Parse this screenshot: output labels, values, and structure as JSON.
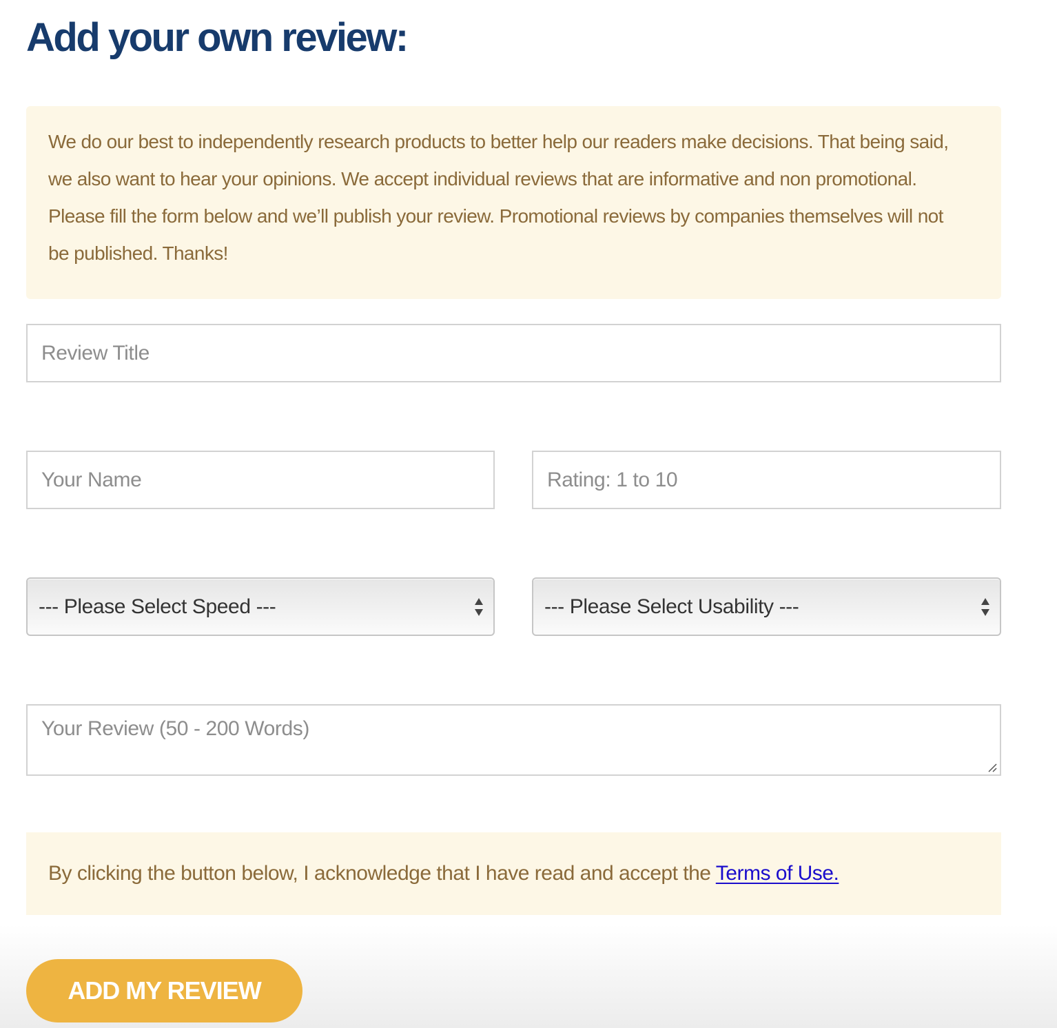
{
  "page": {
    "title": "Add your own review:"
  },
  "notice": {
    "text": "We do our best to independently research products to better help our readers make decisions. That being said, we also want to hear your opinions. We accept individual reviews that are informative and non promotional. Please fill the form below and we’ll publish your review. Promotional reviews by companies themselves will not be published. Thanks!"
  },
  "form": {
    "review_title": {
      "value": "",
      "placeholder": "Review Title"
    },
    "your_name": {
      "value": "",
      "placeholder": "Your Name"
    },
    "rating": {
      "value": "",
      "placeholder": "Rating: 1 to 10"
    },
    "speed_select": {
      "selected": "--- Please Select Speed ---"
    },
    "usability_select": {
      "selected": "--- Please Select Usability ---"
    },
    "your_review": {
      "value": "",
      "placeholder": "Your Review (50 - 200 Words)"
    }
  },
  "terms": {
    "text": "By clicking the button below, I acknowledge that I have read and accept the ",
    "link_label": "Terms of Use."
  },
  "submit": {
    "label": "ADD MY REVIEW"
  },
  "colors": {
    "title": "#173b6c",
    "notice_bg": "#fdf7e6",
    "notice_text": "#8a6a3a",
    "link": "#1a0dcc",
    "button_bg": "#eeb441",
    "button_text": "#ffffff"
  },
  "icons": {
    "rating_spinner": "number-spinner-icon",
    "select_arrows": "select-arrows-icon",
    "resize": "resize-grip-icon"
  }
}
